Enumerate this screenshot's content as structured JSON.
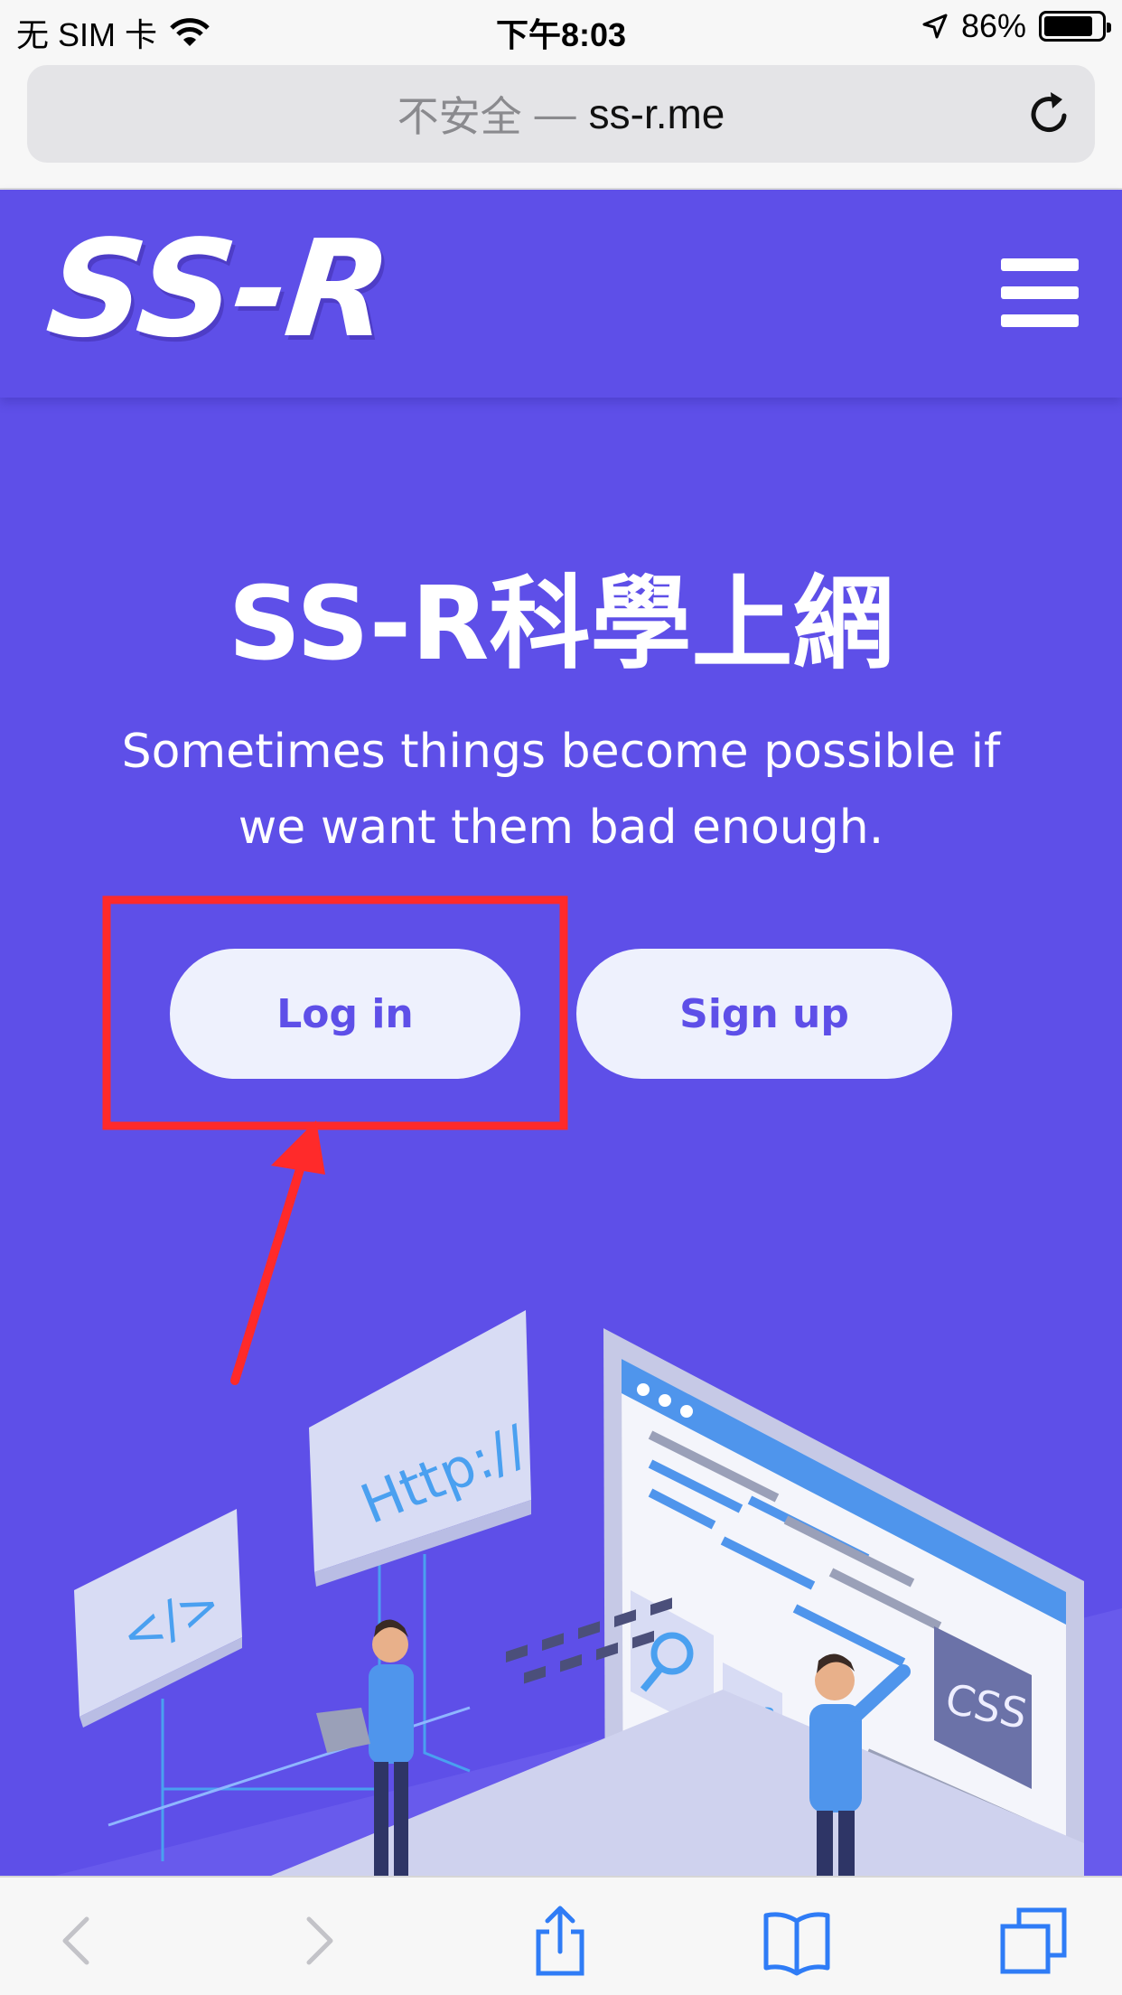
{
  "status_bar": {
    "carrier": "无 SIM 卡",
    "time": "下午8:03",
    "battery": "86%",
    "battery_level": 0.86
  },
  "browser": {
    "insecure_label": "不安全",
    "separator": "—",
    "domain": "ss-r.me"
  },
  "site": {
    "logo_text": "SS-R",
    "title": "SS-R科學上網",
    "subtitle": "Sometimes things become possible if we want them bad enough.",
    "login_label": "Log in",
    "signup_label": "Sign up",
    "illustration_labels": {
      "code_tag": "</>",
      "http": "Http://",
      "braces": "{ }",
      "css": "CSS"
    }
  },
  "colors": {
    "page_bg": "#5e4fe8",
    "button_bg": "#eef1fd",
    "annotation_red": "#ff2a2a"
  },
  "icons": [
    "wifi-icon",
    "location-arrow-icon",
    "battery-icon",
    "reload-icon",
    "menu-icon",
    "back-icon",
    "forward-icon",
    "share-icon",
    "bookmarks-icon",
    "tabs-icon"
  ]
}
